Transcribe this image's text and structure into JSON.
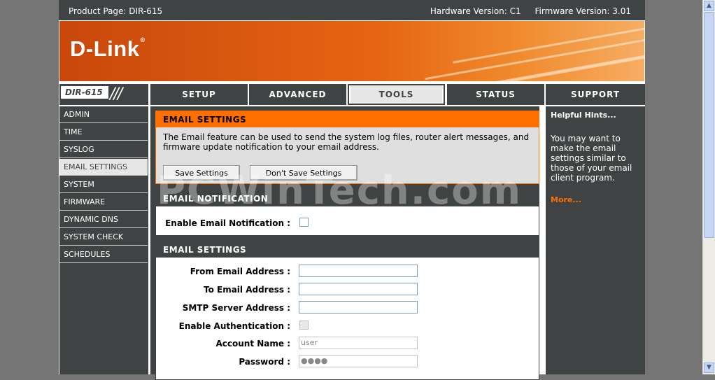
{
  "header": {
    "product_page": "Product Page: DIR-615",
    "hardware_version": "Hardware Version: C1",
    "firmware_version": "Firmware Version: 3.01"
  },
  "brand": {
    "logo": "D-Link",
    "reg_mark": "®",
    "model": "DIR-615"
  },
  "tabs": [
    {
      "label": "SETUP",
      "active": false
    },
    {
      "label": "ADVANCED",
      "active": false
    },
    {
      "label": "TOOLS",
      "active": true
    },
    {
      "label": "STATUS",
      "active": false
    },
    {
      "label": "SUPPORT",
      "active": false
    }
  ],
  "sidebar": {
    "items": [
      {
        "label": "ADMIN"
      },
      {
        "label": "TIME"
      },
      {
        "label": "SYSLOG"
      },
      {
        "label": "EMAIL SETTINGS",
        "active": true
      },
      {
        "label": "SYSTEM"
      },
      {
        "label": "FIRMWARE"
      },
      {
        "label": "DYNAMIC DNS"
      },
      {
        "label": "SYSTEM CHECK"
      },
      {
        "label": "SCHEDULES"
      }
    ]
  },
  "intro": {
    "title": "EMAIL SETTINGS",
    "description": "The Email feature can be used to send the system log files, router alert messages, and firmware update notification to your email address.",
    "save_label": "Save Settings",
    "dont_save_label": "Don't Save Settings"
  },
  "notification": {
    "title": "EMAIL NOTIFICATION",
    "enable_label": "Enable Email Notification :",
    "enabled": false
  },
  "settings": {
    "title": "EMAIL SETTINGS",
    "from_label": "From Email Address :",
    "from_value": "",
    "to_label": "To Email Address :",
    "to_value": "",
    "smtp_label": "SMTP Server Address :",
    "smtp_value": "",
    "auth_label": "Enable Authentication :",
    "auth_enabled": false,
    "account_label": "Account Name :",
    "account_value": "user",
    "password_label": "Password :",
    "password_value": "●●●●"
  },
  "hints": {
    "title": "Helpful Hints...",
    "text": "You may want to make the email settings similar to those of your email client program.",
    "more": "More..."
  },
  "watermark": "PCWinTech.com",
  "colors": {
    "accent": "#ff6f00",
    "dark": "#404343",
    "panel": "#dfdfdf"
  }
}
